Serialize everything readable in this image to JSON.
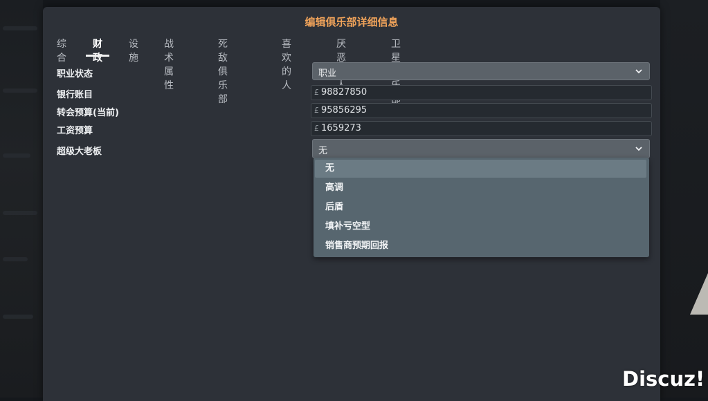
{
  "dialog": {
    "title": "编辑俱乐部详细信息",
    "tabs": [
      {
        "label": "综合"
      },
      {
        "label": "财政"
      },
      {
        "label": "设施"
      },
      {
        "label": "战术属性"
      },
      {
        "label": "死敌俱乐部"
      },
      {
        "label": "喜欢的人"
      },
      {
        "label": "厌恶的人"
      },
      {
        "label": "卫星俱乐部"
      }
    ],
    "active_tab": "财政"
  },
  "form": {
    "professional_status": {
      "label": "职业状态",
      "value": "职业"
    },
    "bank_balance": {
      "label": "银行账目",
      "currency": "£",
      "value": "98827850"
    },
    "transfer_budget": {
      "label": "转会预算(当前)",
      "currency": "£",
      "value": "95856295"
    },
    "wage_budget": {
      "label": "工资预算",
      "currency": "£",
      "value": "1659273"
    },
    "sugar_daddy": {
      "label": "超级大老板",
      "value": "无"
    }
  },
  "dropdown": {
    "options": [
      "无",
      "高调",
      "后盾",
      "填补亏空型",
      "销售商预期回报"
    ],
    "selected": "无"
  },
  "icons": {
    "select_arrow": "chevron-down-icon"
  },
  "colors": {
    "title_accent": "#f0a35a",
    "dialog_bg": "#2d3138"
  },
  "watermark": "Discuz!"
}
